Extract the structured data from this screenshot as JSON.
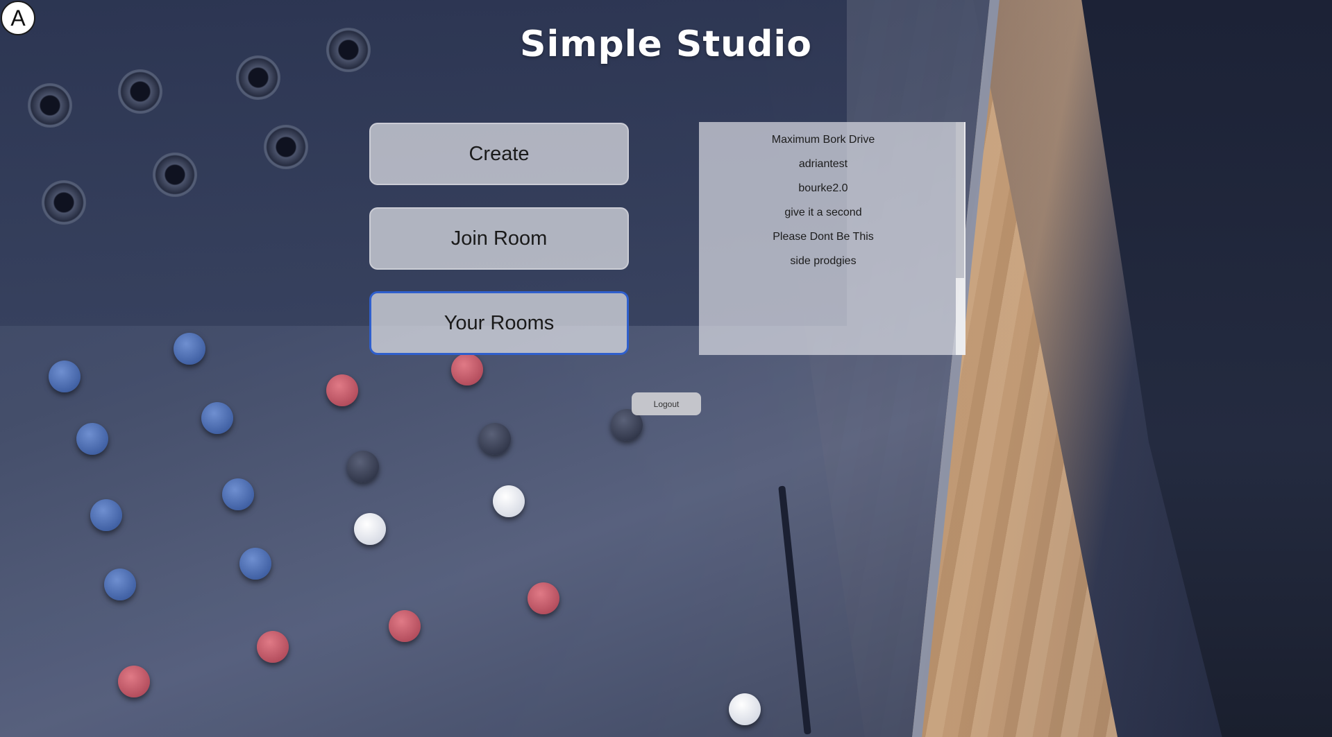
{
  "badge": {
    "letter": "A"
  },
  "app": {
    "title": "Simple Studio"
  },
  "menu": {
    "create_label": "Create",
    "join_label": "Join Room",
    "rooms_label": "Your Rooms"
  },
  "rooms": {
    "items": [
      {
        "name": "Maximum Bork Drive"
      },
      {
        "name": "adriantest"
      },
      {
        "name": "bourke2.0"
      },
      {
        "name": "give it a second"
      },
      {
        "name": "Please Dont Be This"
      },
      {
        "name": "side prodgies"
      }
    ]
  },
  "logout": {
    "label": "Logout"
  },
  "theme": {
    "focus_outline": "#2f5fcc",
    "button_bg": "#e1e2e8",
    "title_color": "#ffffff"
  }
}
